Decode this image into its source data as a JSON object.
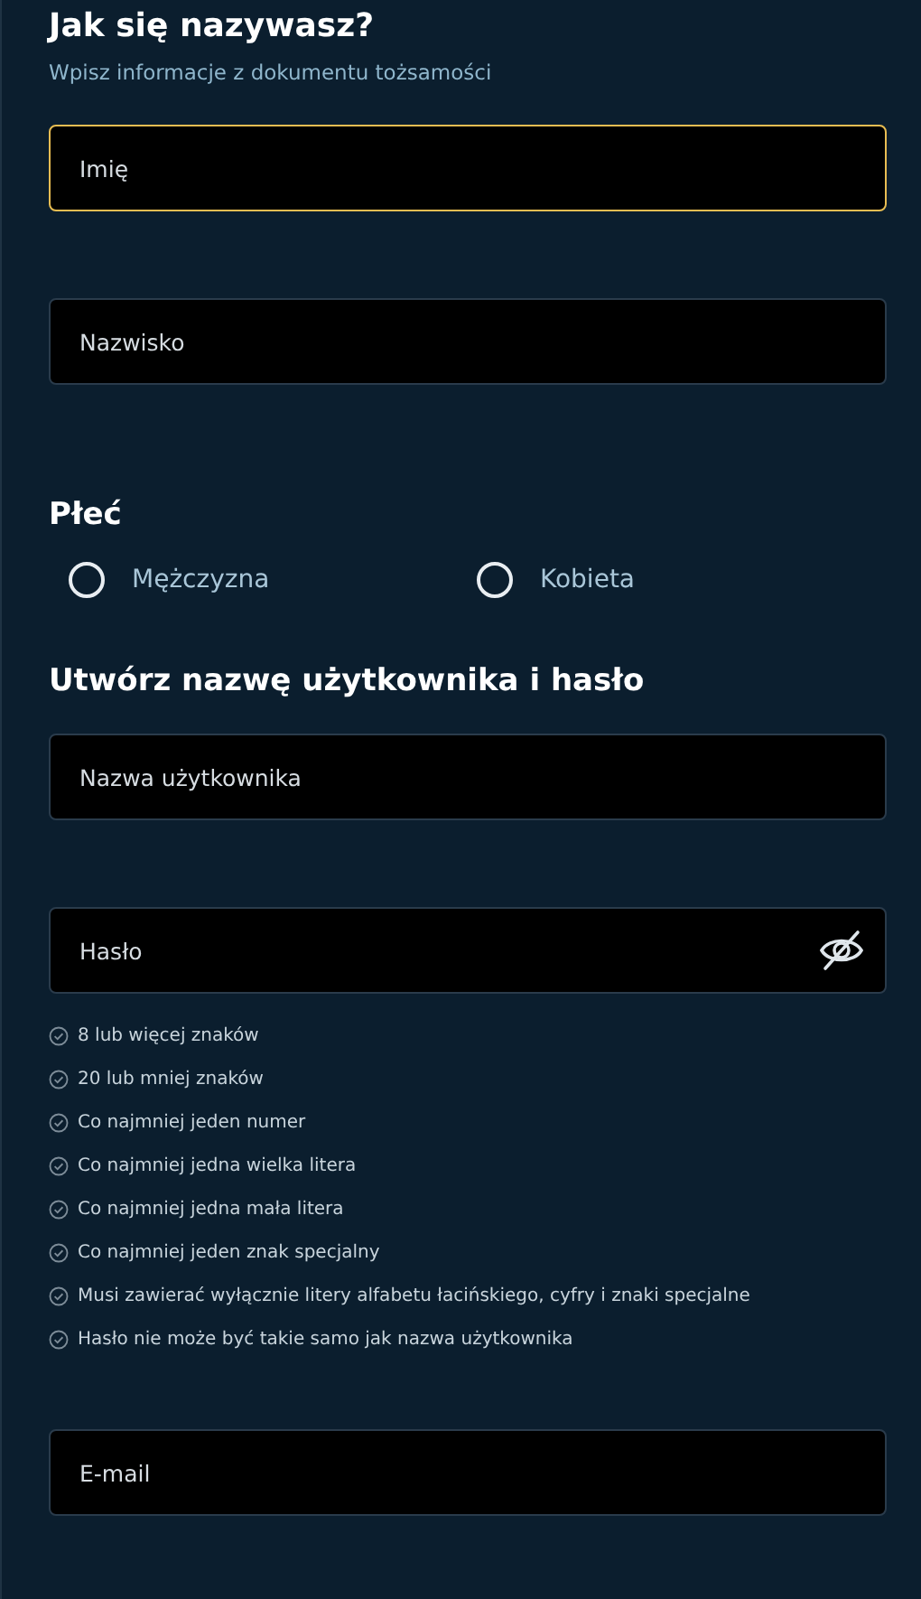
{
  "heading": "Jak się nazywasz?",
  "subtitle": "Wpisz informacje z dokumentu tożsamości",
  "name_fields": [
    {
      "placeholder": "Imię",
      "focused": true
    },
    {
      "placeholder": "Nazwisko",
      "focused": false
    }
  ],
  "gender": {
    "title": "Płeć",
    "options": [
      {
        "label": "Mężczyzna",
        "selected": false
      },
      {
        "label": "Kobieta",
        "selected": false
      }
    ]
  },
  "account": {
    "title": "Utwórz nazwę użytkownika i hasło",
    "username": {
      "placeholder": "Nazwa użytkownika",
      "focused": false
    },
    "password": {
      "placeholder": "Hasło",
      "focused": false
    },
    "rules": [
      "8 lub więcej znaków",
      "20 lub mniej znaków",
      "Co najmniej jeden numer",
      "Co najmniej jedna wielka litera",
      "Co najmniej jedna mała litera",
      "Co najmniej jeden znak specjalny",
      "Musi zawierać wyłącznie litery alfabetu łacińskiego, cyfry i znaki specjalne",
      "Hasło nie może być takie samo jak nazwa użytkownika"
    ],
    "email": {
      "placeholder": "E-mail",
      "focused": false
    }
  }
}
